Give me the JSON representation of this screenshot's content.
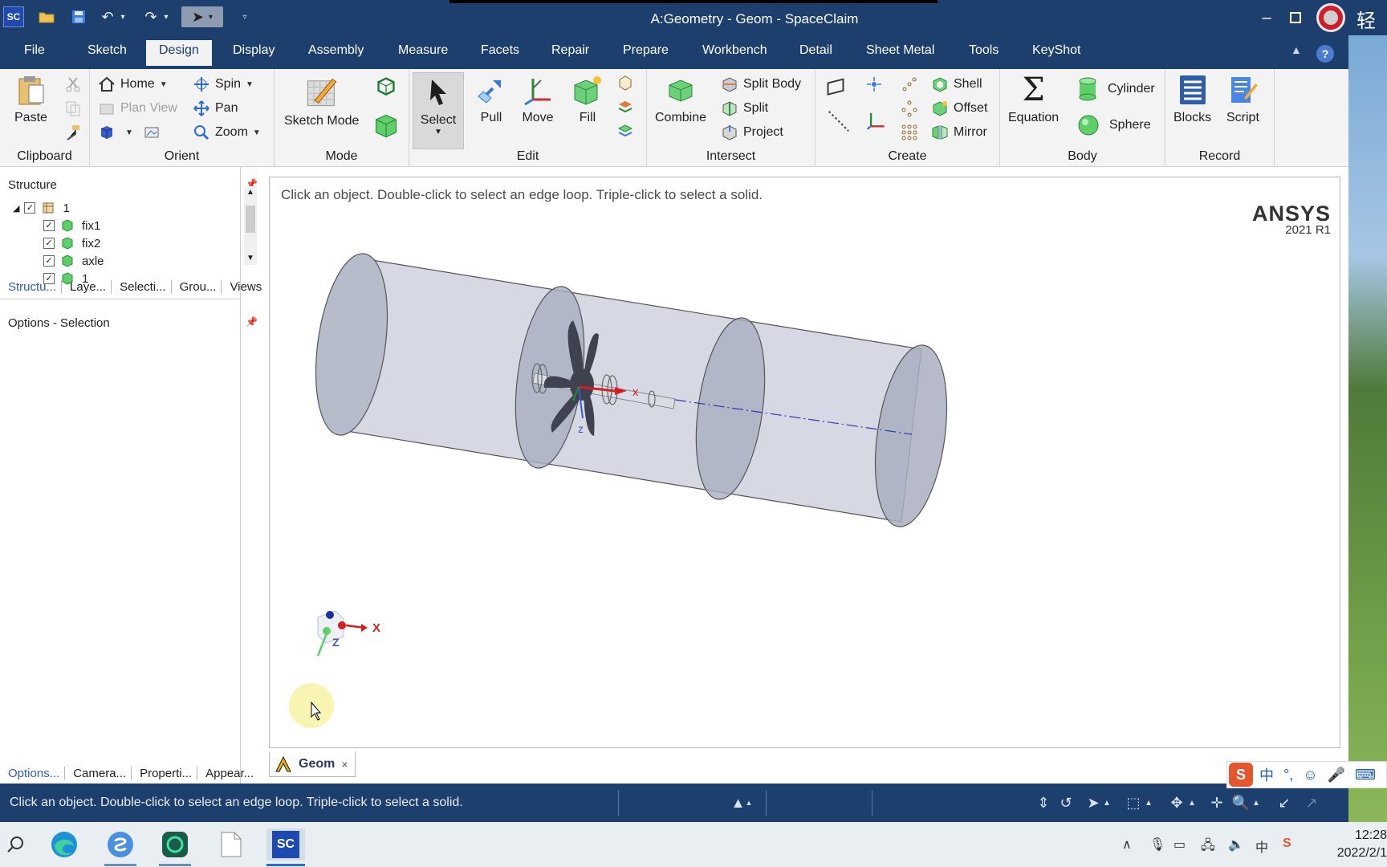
{
  "window": {
    "title": "A:Geometry - Geom - SpaceClaim",
    "app_badge": "SC",
    "corner_char": "轻"
  },
  "menu": {
    "items": [
      "File",
      "Sketch",
      "Design",
      "Display",
      "Assembly",
      "Measure",
      "Facets",
      "Repair",
      "Prepare",
      "Workbench",
      "Detail",
      "Sheet Metal",
      "Tools",
      "KeyShot"
    ],
    "active": "Design"
  },
  "ribbon": {
    "clipboard": {
      "label": "Clipboard",
      "paste": "Paste"
    },
    "orient": {
      "label": "Orient",
      "home": "Home",
      "plan_view": "Plan View",
      "spin": "Spin",
      "pan": "Pan",
      "zoom": "Zoom"
    },
    "mode": {
      "label": "Mode",
      "sketch_mode": "Sketch Mode"
    },
    "edit": {
      "label": "Edit",
      "select": "Select",
      "pull": "Pull",
      "move": "Move",
      "fill": "Fill"
    },
    "intersect": {
      "label": "Intersect",
      "combine": "Combine",
      "split_body": "Split Body",
      "split": "Split",
      "project": "Project"
    },
    "create": {
      "label": "Create",
      "shell": "Shell",
      "offset": "Offset",
      "mirror": "Mirror"
    },
    "body": {
      "label": "Body",
      "equation": "Equation",
      "cylinder": "Cylinder",
      "sphere": "Sphere"
    },
    "record": {
      "label": "Record",
      "blocks": "Blocks",
      "script": "Script"
    }
  },
  "structure": {
    "header": "Structure",
    "root": "1",
    "children": [
      "fix1",
      "fix2",
      "axle",
      "1"
    ],
    "tabs": [
      "Structu...",
      "Laye...",
      "Selecti...",
      "Grou...",
      "Views"
    ]
  },
  "options": {
    "header": "Options - Selection",
    "tabs": [
      "Options...",
      "Camera...",
      "Properti...",
      "Appear..."
    ]
  },
  "viewport": {
    "hint": "Click an object. Double-click to select an edge loop. Triple-click to select a solid.",
    "brand": "ANSYS",
    "version": "2021 R1",
    "axis_x": "x",
    "axis_z": "z",
    "triad_x": "X",
    "triad_z": "Z"
  },
  "doc_tab": {
    "label": "Geom",
    "close": "×"
  },
  "status": {
    "text": "Click an object. Double-click to select an edge loop. Triple-click to select a solid."
  },
  "ime": {
    "logo": "S",
    "lang": "中",
    "punct": "°,"
  },
  "taskbar": {
    "time": "12:28",
    "date": "2022/2/1",
    "sc_badge": "SC",
    "tray_lang": "中"
  },
  "colors": {
    "title_bar": "#1c3f6e",
    "ribbon_bg": "#f3f3f3",
    "accent": "#2f5ea8",
    "body_fill": "#c8ccd9"
  }
}
